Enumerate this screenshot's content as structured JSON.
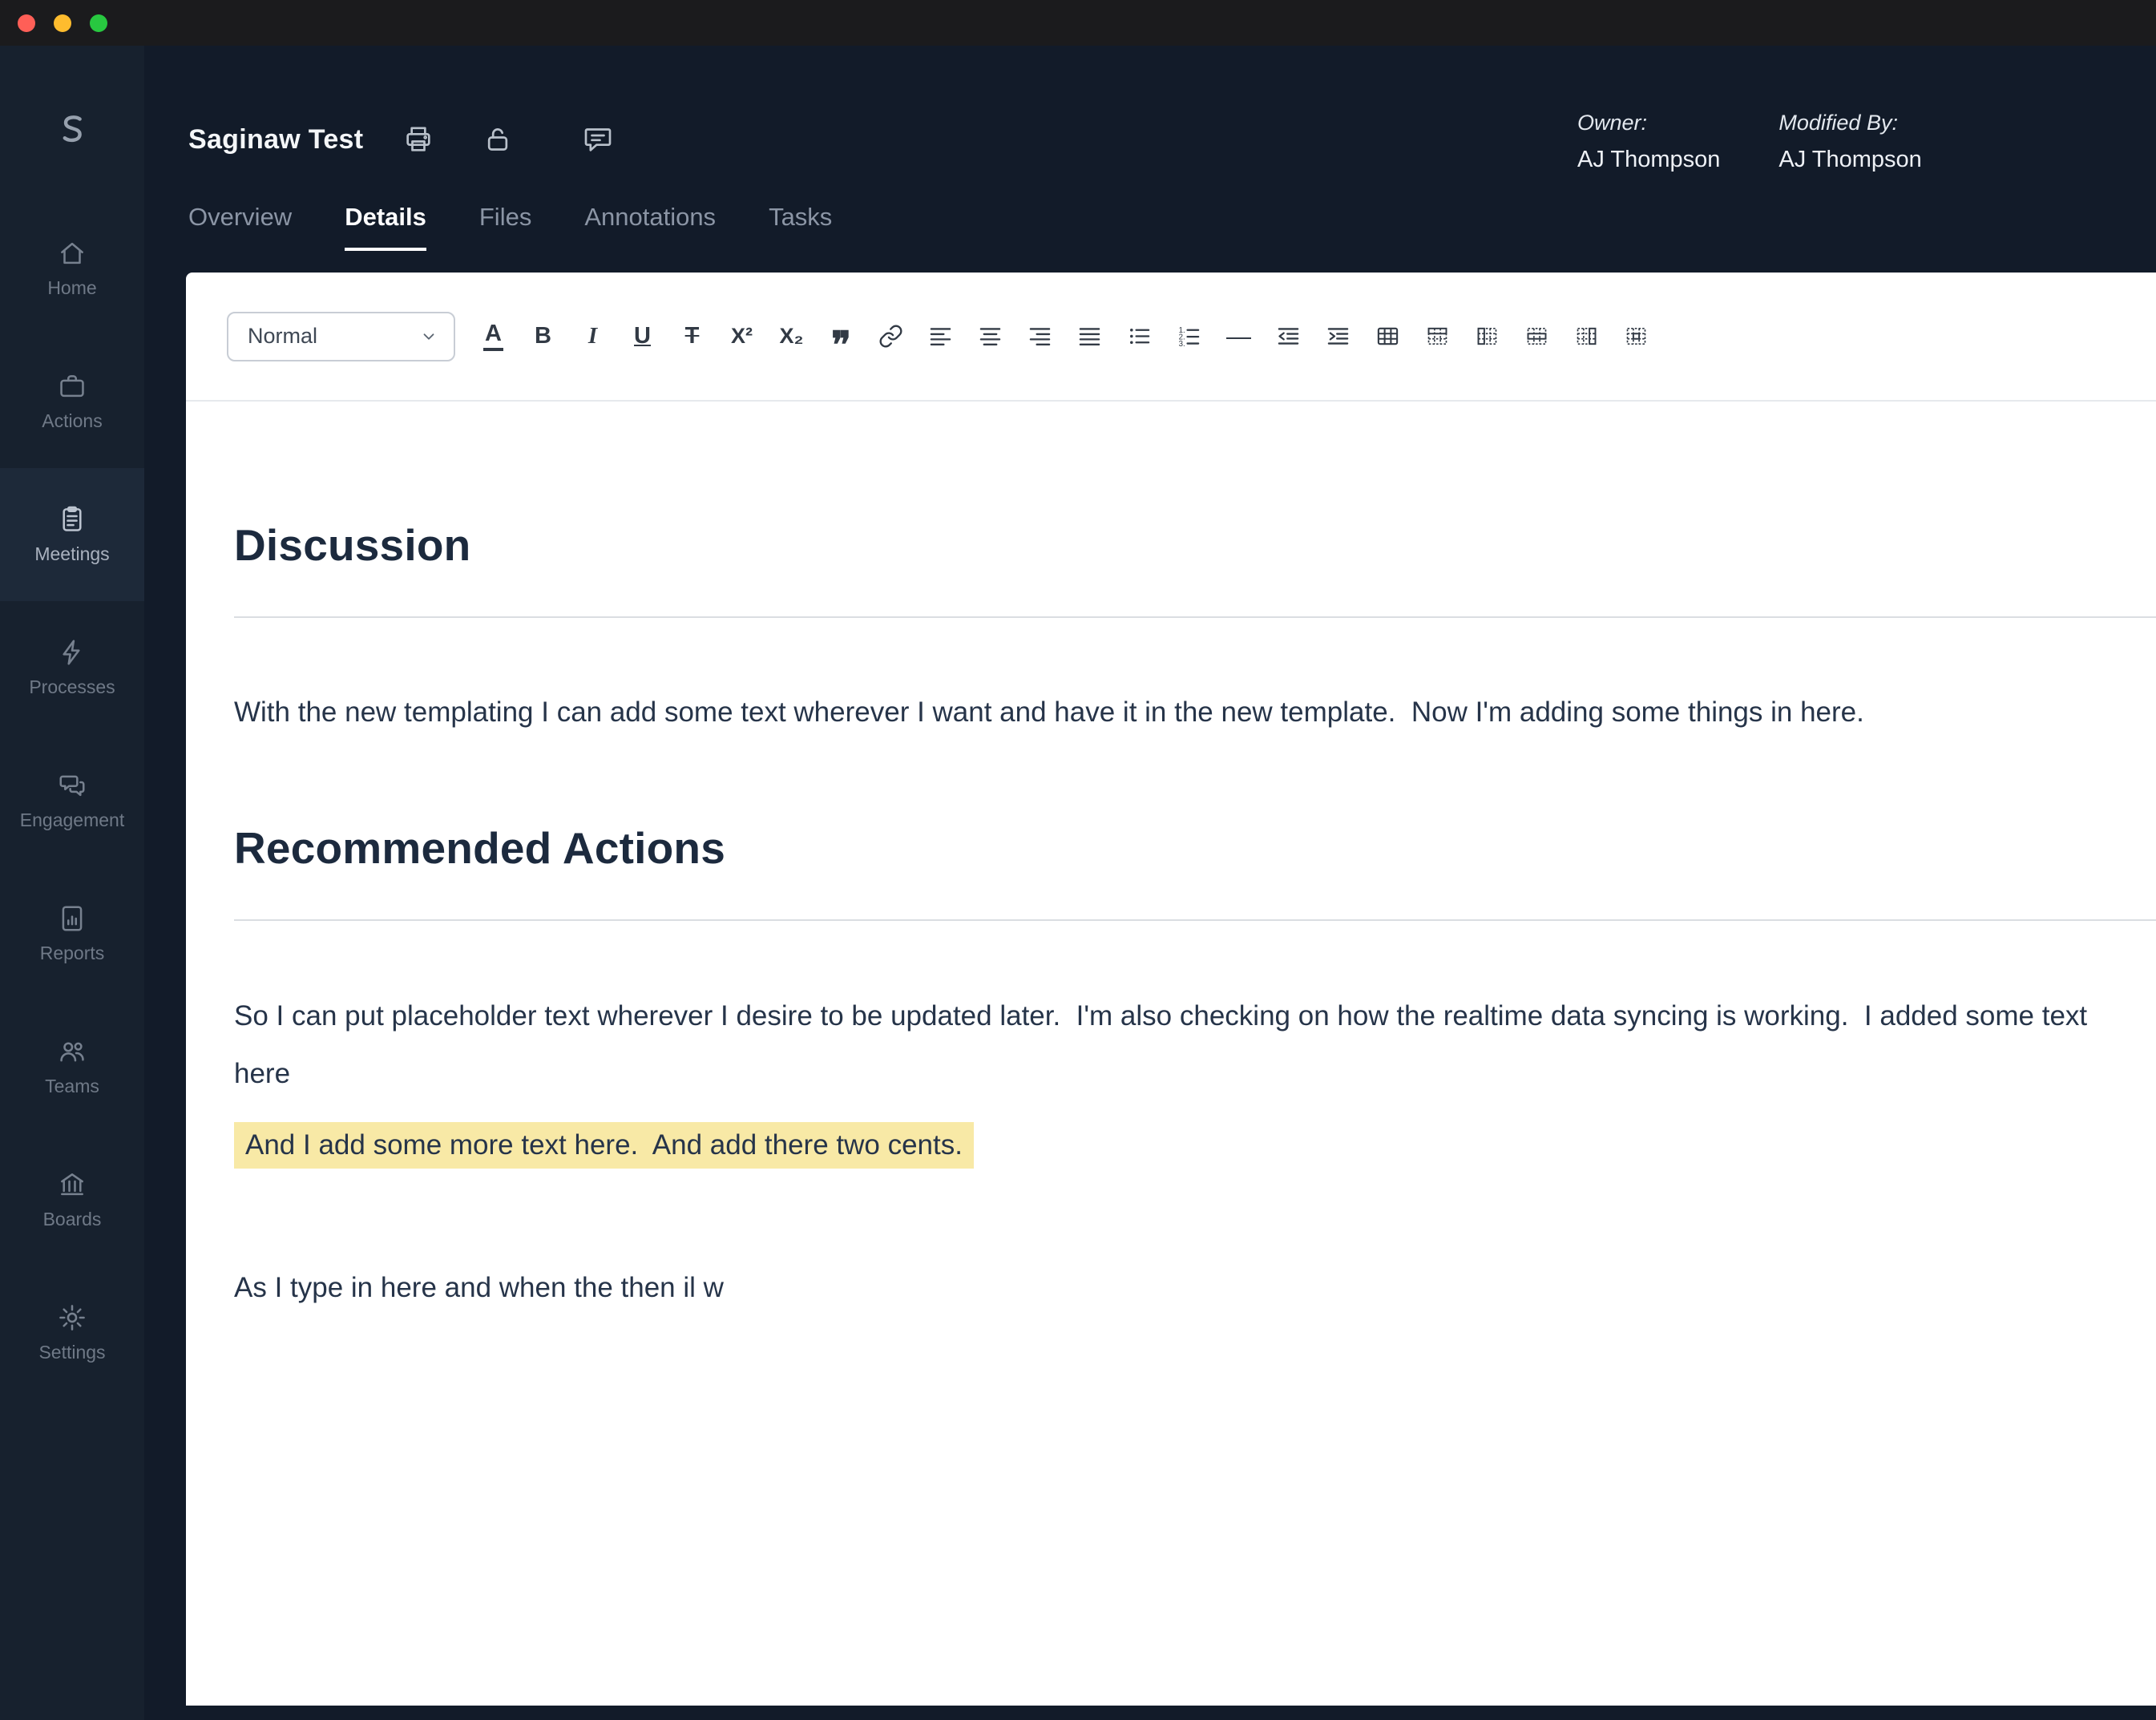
{
  "header": {
    "title": "Saginaw Test",
    "owner_label": "Owner:",
    "owner_value": "AJ Thompson",
    "modified_label": "Modified By:",
    "modified_value": "AJ Thompson"
  },
  "tabs": [
    {
      "label": "Overview",
      "active": false
    },
    {
      "label": "Details",
      "active": true
    },
    {
      "label": "Files",
      "active": false
    },
    {
      "label": "Annotations",
      "active": false
    },
    {
      "label": "Tasks",
      "active": false
    }
  ],
  "sidebar": {
    "items": [
      {
        "label": "Home",
        "active": false
      },
      {
        "label": "Actions",
        "active": false
      },
      {
        "label": "Meetings",
        "active": true
      },
      {
        "label": "Processes",
        "active": false
      },
      {
        "label": "Engagement",
        "active": false
      },
      {
        "label": "Reports",
        "active": false
      },
      {
        "label": "Teams",
        "active": false
      },
      {
        "label": "Boards",
        "active": false
      },
      {
        "label": "Settings",
        "active": false
      }
    ]
  },
  "toolbar": {
    "format_select": "Normal",
    "glyphs": {
      "text_color": "A",
      "bold": "B",
      "italic": "I",
      "underline": "U",
      "strikethrough": "T",
      "superscript": "X²",
      "subscript": "X₂",
      "blockquote": "❞",
      "horizontal_rule": "—"
    }
  },
  "editor": {
    "heading_discussion": "Discussion",
    "para_discussion": "With the new templating I can add some text wherever I want and have it in the new template.  Now I'm adding some things in here.",
    "heading_recommended": "Recommended Actions",
    "para_recommended_line1": "So I can put placeholder text wherever I desire to be updated later.  I'm also checking on how the realtime data syncing is working.  I added some text",
    "para_recommended_line2": "here",
    "highlight_text": "And I add some more text here.  And add there two cents.",
    "para_typing": "As I type in here and when the then il w"
  },
  "colors": {
    "highlight_bg": "#f8e9a6",
    "sidebar_bg": "#17212e",
    "header_bg": "#121b29",
    "active_tab_underline": "#ffffff"
  }
}
